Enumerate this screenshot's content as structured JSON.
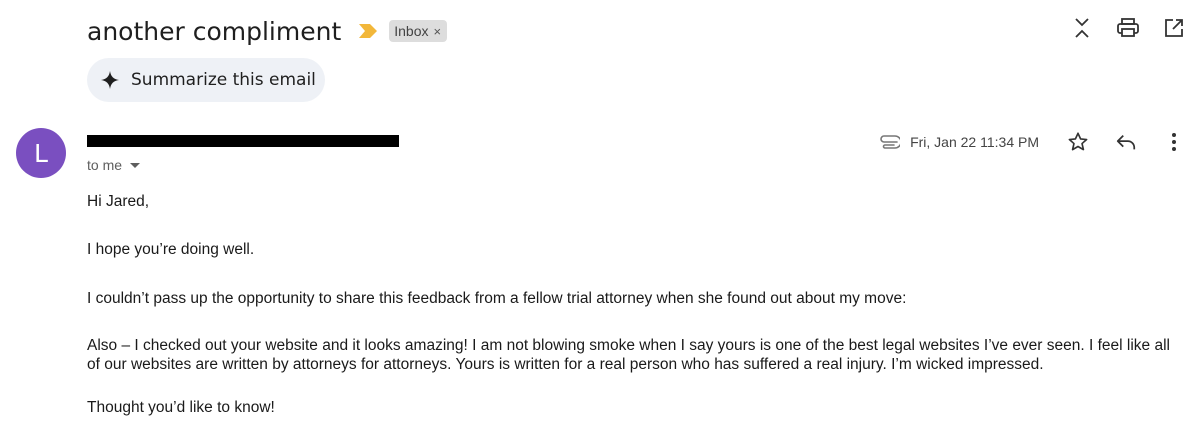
{
  "email": {
    "subject": "another compliment",
    "label": "Inbox",
    "label_remove": "×",
    "summarize_label": "Summarize this email",
    "avatar_letter": "L",
    "to": "to me",
    "date": "Fri, Jan 22 11:34 PM",
    "body": [
      "Hi Jared,",
      "I hope you’re doing well.",
      "I couldn’t pass up the opportunity to share this feedback from a fellow trial attorney when she found out about my move:",
      "Also – I checked out your website and it looks amazing! I am not blowing smoke when I say yours is one of the best legal websites I’ve ever seen. I feel like all of our websites are written by attorneys for attorneys. Yours is written for a real person who has suffered a real injury. I’m wicked impressed.",
      "Thought you’d like to know!"
    ]
  },
  "icons": {
    "importance": "importance-marker-icon",
    "collapse": "collapse-all-icon",
    "print": "print-icon",
    "popout": "open-in-new-window-icon",
    "sparkle": "sparkle-icon",
    "attachment": "attachment-icon",
    "star": "star-icon",
    "reply": "reply-icon",
    "more": "more-vertical-icon"
  },
  "colors": {
    "avatar": "#7a4fc0",
    "importance": "#f2b73a",
    "chip_bg": "#dddddd",
    "summarize_bg": "#eef1f6"
  }
}
